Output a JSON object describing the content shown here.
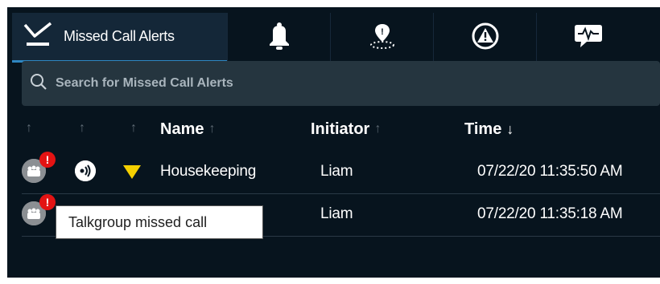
{
  "tabs": [
    {
      "label": "Missed Call Alerts",
      "icon": "checkmark-inbox-icon",
      "active": true
    },
    {
      "label": "",
      "icon": "bell-icon",
      "active": false
    },
    {
      "label": "",
      "icon": "location-pin-icon",
      "active": false
    },
    {
      "label": "",
      "icon": "warning-icon",
      "active": false
    },
    {
      "label": "",
      "icon": "voice-chat-icon",
      "active": false
    }
  ],
  "search": {
    "placeholder": "Search for Missed Call Alerts",
    "value": ""
  },
  "columns": {
    "sort1_arrow": "↑",
    "sort2_arrow": "↑",
    "sort3_arrow": "↑",
    "name": "Name",
    "name_arrow": "↑",
    "initiator": "Initiator",
    "initiator_arrow": "↑",
    "time": "Time",
    "time_arrow": "↓"
  },
  "rows": [
    {
      "badge": "!",
      "name": "Housekeeping",
      "initiator": "Liam",
      "time": "07/22/20 11:35:50 AM",
      "priority_color": "#f5d000"
    },
    {
      "badge": "!",
      "name": "",
      "initiator": "Liam",
      "time": "07/22/20 11:35:18 AM"
    }
  ],
  "tooltip": {
    "text": "Talkgroup missed call"
  },
  "colors": {
    "accent": "#2e86c1",
    "alert": "#e31313",
    "background": "#07141e"
  }
}
